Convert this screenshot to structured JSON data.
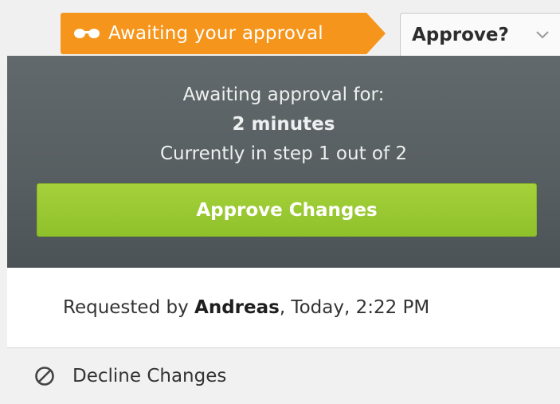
{
  "toolbar": {
    "status_label": "Awaiting your approval",
    "status_icon": "glasses-icon",
    "status_color": "#f6951b",
    "dropdown_label": "Approve?",
    "dropdown_icon": "chevron-down-icon"
  },
  "panel": {
    "line1": "Awaiting approval for:",
    "duration": "2 minutes",
    "step_text": "Currently in step 1 out of 2",
    "approve_button": "Approve Changes",
    "approve_color": "#9acb32",
    "background_color": "#5a6164"
  },
  "request": {
    "prefix": "Requested by ",
    "user": "Andreas",
    "suffix": ", Today, 2:22 PM"
  },
  "decline": {
    "label": "Decline Changes",
    "icon": "ban-icon"
  }
}
